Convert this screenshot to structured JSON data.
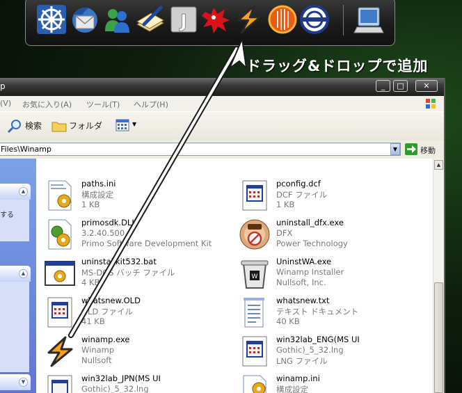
{
  "dock": {
    "icons": [
      "helm-icon",
      "thunderbird-icon",
      "messenger-icon",
      "notepad-pen-icon",
      "j-app-icon",
      "red-splat-icon",
      "winamp-icon",
      "firefox-icon",
      "emblem-icon",
      "computer-icon"
    ]
  },
  "instruction": "ドラッグ&ドロップで追加",
  "window": {
    "title": "p",
    "menu": [
      "(V)",
      "お気に入り(A)",
      "ツール(T)",
      "ヘルプ(H)"
    ],
    "toolbar": {
      "search": "検索",
      "folders": "フォルダ"
    },
    "address": "Files\\Winamp",
    "go": "移動"
  },
  "tasks": {
    "snippet": "する"
  },
  "files": [
    {
      "name": "paths.ini",
      "type": "構成設定",
      "info": "1 KB",
      "icon": "ini-icon"
    },
    {
      "name": "pconfig.dcf",
      "type": "DCF ファイル",
      "info": "1 KB",
      "icon": "document-icon"
    },
    {
      "name": "primosdk.DLL",
      "type": "3.2.40.500",
      "info": "Primo Software Development Kit",
      "icon": "dll-icon"
    },
    {
      "name": "uninstall_dfx.exe",
      "type": "DFX",
      "info": "Power Technology",
      "icon": "dfx-disc-icon"
    },
    {
      "name": "uninstallkit532.bat",
      "type": "MS-DOS バッチ ファイル",
      "info": "4 KB",
      "icon": "batch-icon"
    },
    {
      "name": "UninstWA.exe",
      "type": "Winamp Installer",
      "info": "Nullsoft, Inc.",
      "icon": "recycle-bin-icon"
    },
    {
      "name": "whatsnew.OLD",
      "type": "OLD ファイル",
      "info": "41 KB",
      "icon": "document-icon"
    },
    {
      "name": "whatsnew.txt",
      "type": "テキスト ドキュメント",
      "info": "40 KB",
      "icon": "text-file-icon"
    },
    {
      "name": "winamp.exe",
      "type": "Winamp",
      "info": "Nullsoft",
      "icon": "winamp-icon"
    },
    {
      "name": "win32lab_ENG(MS UI",
      "type": "Gothic)_5_32.lng",
      "info": "LNG ファイル",
      "icon": "document-icon"
    },
    {
      "name": "win32lab_JPN(MS UI",
      "type": "Gothic)_5_32.lng",
      "info": "",
      "icon": "document-icon"
    },
    {
      "name": "winamp.ini",
      "type": "構成設定",
      "info": "",
      "icon": "ini-icon"
    }
  ]
}
